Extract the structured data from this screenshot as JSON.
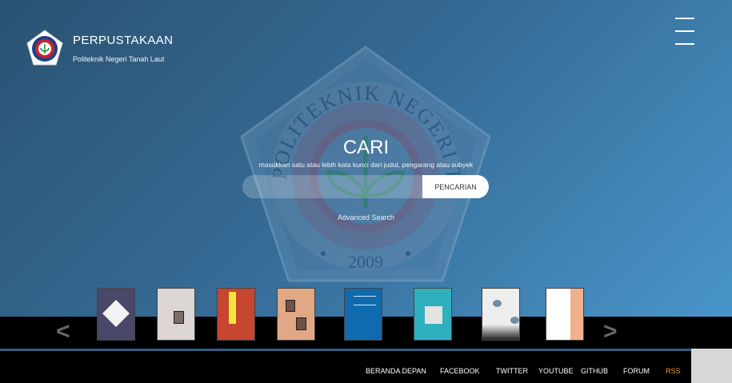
{
  "header": {
    "title": "PERPUSTAKAAN",
    "subtitle": "Politeknik Negeri Tanah Laut",
    "menu_icon": "hamburger-icon"
  },
  "watermark": {
    "arc_text": "POLITEKNIK NEGERI TANAH LAUT",
    "year": "2009"
  },
  "search": {
    "title": "CARI",
    "hint": "masukkan satu atau lebih kata kunci dari judul, pengarang atau subyek",
    "input_value": "",
    "button_label": "PENCARIAN",
    "advanced_label": "Advanced Search"
  },
  "carousel": {
    "prev_label": "<",
    "next_label": ">",
    "books": [
      {
        "name": "book-cover-1",
        "color": "#4a4868"
      },
      {
        "name": "book-cover-2",
        "color": "#dcd6d5"
      },
      {
        "name": "book-cover-3",
        "color": "#c6462f"
      },
      {
        "name": "book-cover-4",
        "color": "#e2a784"
      },
      {
        "name": "book-cover-5",
        "color": "#0f6aae"
      },
      {
        "name": "book-cover-6",
        "color": "#2fb0bf"
      },
      {
        "name": "book-cover-7",
        "color": "#eeeeee"
      },
      {
        "name": "book-cover-8",
        "color": "#f3b08c"
      }
    ]
  },
  "footer": {
    "links": [
      "BERANDA DEPAN",
      "FACEBOOK",
      "TWITTER",
      "YOUTUBE",
      "GITHUB",
      "FORUM",
      "RSS"
    ],
    "rss_color": "#f0a030"
  }
}
